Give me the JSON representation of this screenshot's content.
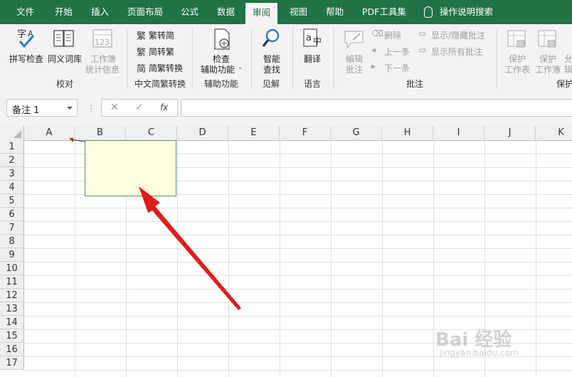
{
  "tabs": [
    "文件",
    "开始",
    "插入",
    "页面布局",
    "公式",
    "数据",
    "审阅",
    "视图",
    "帮助",
    "PDF工具集"
  ],
  "active_tab": "审阅",
  "tell_me": "操作说明搜索",
  "ribbon": {
    "proofing": {
      "spelling": "拼写检查",
      "thesaurus": "同义词库",
      "workbook_stats_1": "工作簿",
      "workbook_stats_2": "统计信息",
      "group_label": "校对"
    },
    "chinese_conversion": {
      "to_simplified": "繁转简",
      "to_traditional": "简转繁",
      "conversion": "简繁转换",
      "group_label": "中文简繁转换"
    },
    "accessibility": {
      "check_1": "检查",
      "check_2": "辅助功能",
      "group_label": "辅助功能"
    },
    "insights": {
      "smart_lookup_1": "智能",
      "smart_lookup_2": "查找",
      "group_label": "见解"
    },
    "language": {
      "translate": "翻译",
      "group_label": "语言"
    },
    "comments": {
      "edit_1": "编辑",
      "edit_2": "批注",
      "delete": "删除",
      "previous": "上一条",
      "next": "下一条",
      "show_hide": "显示/隐藏批注",
      "show_all": "显示所有批注",
      "group_label": "批注"
    },
    "protect": {
      "protect_sheet_1": "保护",
      "protect_sheet_2": "工作表",
      "protect_workbook_1": "保护",
      "protect_workbook_2": "工作簿",
      "allow_edit_1": "允",
      "allow_edit_2": "辑",
      "group_label": "保护"
    }
  },
  "formula_bar": {
    "name_box": "备注 1",
    "fx": "fx",
    "value": ""
  },
  "columns": [
    "A",
    "B",
    "C",
    "D",
    "E",
    "F",
    "G",
    "H",
    "I",
    "J",
    "K"
  ],
  "rows": [
    "1",
    "2",
    "3",
    "4",
    "5",
    "6",
    "7",
    "8",
    "9",
    "10",
    "11",
    "12",
    "13",
    "14",
    "15",
    "16",
    "17"
  ],
  "comment_box_text": "",
  "watermark": "Bai 经验",
  "watermark_url": "jingyan.baidu.com",
  "colors": {
    "excel_green": "#217346",
    "annotation_arrow": "#e31b1b",
    "comment_fill": "#ffffe1"
  }
}
